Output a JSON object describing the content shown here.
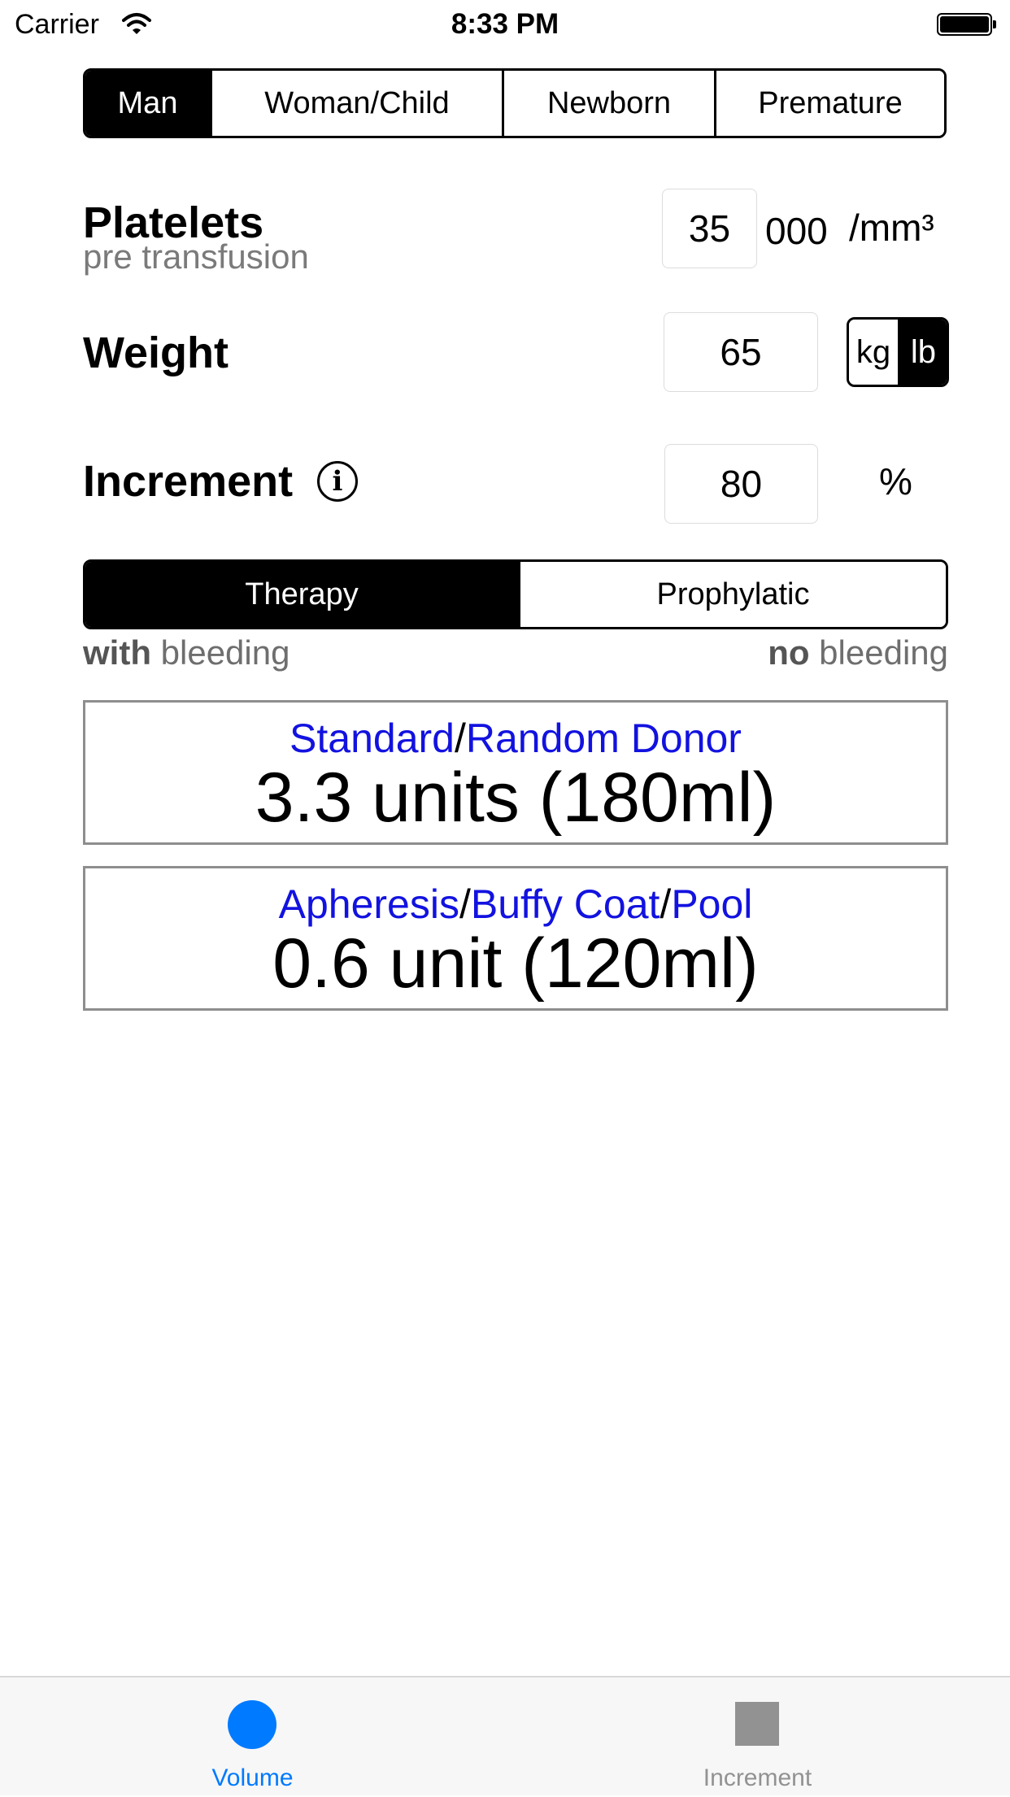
{
  "status_bar": {
    "carrier": "Carrier",
    "time": "8:33 PM"
  },
  "gender_segments": [
    {
      "label": "Man",
      "selected": true
    },
    {
      "label": "Woman/Child",
      "selected": false
    },
    {
      "label": "Newborn",
      "selected": false
    },
    {
      "label": "Premature",
      "selected": false
    }
  ],
  "platelets": {
    "label": "Platelets",
    "sublabel": "pre transfusion",
    "value": "35",
    "thousands_suffix": "000",
    "unit": "/mm³"
  },
  "weight": {
    "label": "Weight",
    "value": "65",
    "units": [
      {
        "label": "kg",
        "selected": false
      },
      {
        "label": "lb",
        "selected": true
      }
    ]
  },
  "increment": {
    "label": "Increment",
    "info_glyph": "i",
    "value": "80",
    "unit": "%"
  },
  "mode_segments": [
    {
      "label": "Therapy",
      "selected": true
    },
    {
      "label": "Prophylatic",
      "selected": false
    }
  ],
  "bleeding": {
    "left_bold": "with",
    "left_rest": " bleeding",
    "right_bold": "no",
    "right_rest": " bleeding"
  },
  "results": {
    "standard": {
      "type_part1": "Standard",
      "sep": "/",
      "type_part2": "Random Donor",
      "value": "3.3 units (180ml)"
    },
    "apheresis": {
      "type_part1": "Apheresis",
      "sep1": "/",
      "type_part2": "Buffy Coat",
      "sep2": "/",
      "type_part3": "Pool",
      "value": "0.6 unit (120ml)"
    }
  },
  "tabs": [
    {
      "label": "Volume",
      "icon": "circle-icon",
      "selected": true,
      "color": "#007aff"
    },
    {
      "label": "Increment",
      "icon": "square-icon",
      "selected": false,
      "color": "#929292"
    }
  ],
  "colors": {
    "link": "#1212e0",
    "accent": "#007aff"
  }
}
